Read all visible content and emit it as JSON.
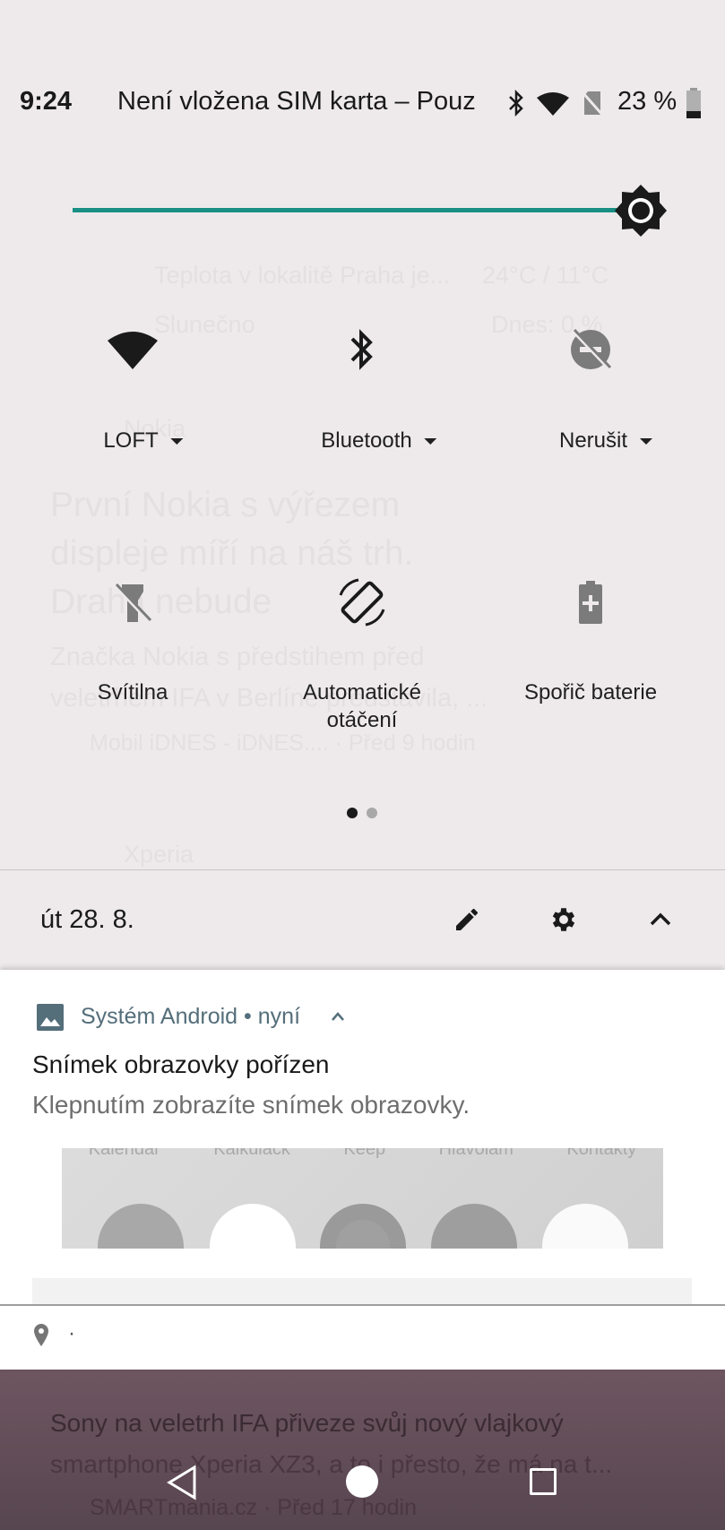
{
  "status_bar": {
    "time": "9:24",
    "carrier": "Není vložena SIM karta – Pouz",
    "battery": "23 %",
    "icons": [
      "bluetooth-icon",
      "wifi-icon",
      "no-sim-icon",
      "battery-icon"
    ]
  },
  "brightness": {
    "level_percent": 97,
    "accent": "#1a8f84"
  },
  "background": {
    "weather": "Teplota v lokalitě Praha je...",
    "weather_sub": "Slunečno",
    "temp": "24°C / 11°C",
    "rain": "Dnes: 0 %",
    "source1": "Nokia",
    "headline1": "První Nokia s výřezem displeje míří na náš trh. Drahá nebude",
    "snippet1": "Značka Nokia s předstihem před veletrhem IFA v Berlíně představila, ...",
    "meta1": "Mobil iDNES - iDNES.... · Před 9 hodin",
    "source2": "Xperia",
    "snippet2a": "Sony na veletrh IFA přiveze svůj nový vlajkový",
    "snippet2b": "smartphone Xperia XZ3, a to i přesto, že má na t...",
    "meta2": "SMARTmania.cz · Před 17 hodin"
  },
  "tiles": [
    {
      "label": "LOFT",
      "icon": "wifi-icon",
      "dropdown": true
    },
    {
      "label": "Bluetooth",
      "icon": "bluetooth-icon",
      "dropdown": true
    },
    {
      "label": "Nerušit",
      "icon": "do-not-disturb-icon",
      "dropdown": true
    },
    {
      "label": "Svítilna",
      "icon": "flashlight-off-icon"
    },
    {
      "label": "Automatické",
      "label2": "otáčení",
      "icon": "auto-rotate-icon"
    },
    {
      "label": "Spořič baterie",
      "icon": "battery-saver-icon"
    }
  ],
  "pager": {
    "pages": 2,
    "current": 1
  },
  "footer": {
    "date": "út 28. 8.",
    "icons": [
      "edit-icon",
      "settings-icon",
      "collapse-icon"
    ]
  },
  "notification": {
    "app": "Systém Android",
    "time": "nyní",
    "separator": "•",
    "title": "Snímek obrazovky pořízen",
    "text": "Klepnutím zobrazíte snímek obrazovky.",
    "preview_labels": [
      "Kalendář",
      "Kalkulačk",
      "Keep",
      "Hlavolam",
      "Kontakty"
    ]
  },
  "location_row": {
    "text": "·"
  },
  "nav": {
    "buttons": [
      "back",
      "home",
      "recents"
    ]
  }
}
